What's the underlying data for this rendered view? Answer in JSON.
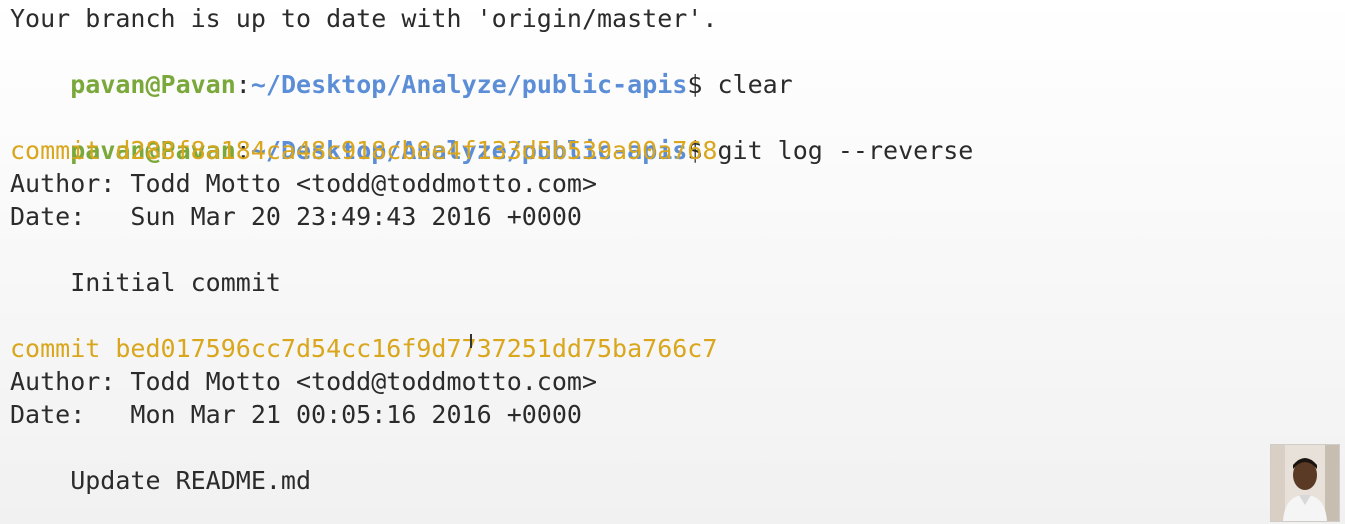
{
  "terminal": {
    "lines": {
      "status": "Your branch is up to date with 'origin/master'.",
      "prompt1": {
        "user": "pavan@Pavan",
        "colon": ":",
        "path": "~/Desktop/Analyze/public-apis",
        "dollar": "$",
        "command": " clear"
      },
      "prompt2": {
        "user": "pavan@Pavan",
        "colon": ":",
        "path": "~/Desktop/Analyze/public-apis",
        "dollar": "$",
        "command": " git log --reverse"
      },
      "commit1": {
        "header": "commit d288f8a184ca48c918cb8e4f133d5b539a90a768",
        "author": "Author: Todd Motto <todd@toddmotto.com>",
        "date": "Date:   Sun Mar 20 23:49:43 2016 +0000",
        "message": "    Initial commit"
      },
      "commit2": {
        "header": "commit bed017596cc7d54cc16f9d7737251dd75ba766c7",
        "author": "Author: Todd Motto <todd@toddmotto.com>",
        "date": "Date:   Mon Mar 21 00:05:16 2016 +0000",
        "message": "    Update README.md"
      }
    },
    "colors": {
      "user": "#7aa83a",
      "path": "#5b8ed6",
      "commit": "#d9a61c",
      "text": "#2b2b2b"
    }
  },
  "overlay": {
    "webcam_icon": "person-avatar-icon"
  }
}
